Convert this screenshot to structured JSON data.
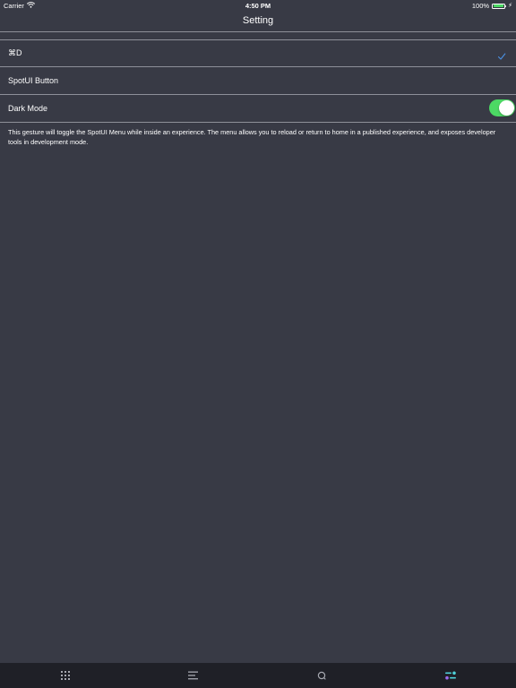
{
  "status_bar": {
    "carrier": "Carrier",
    "time": "4:50 PM",
    "battery": "100%",
    "battery_level": 1.0
  },
  "nav": {
    "title": "Setting"
  },
  "settings": {
    "rows": [
      {
        "label": "⌘D",
        "accessory": "checkmark-icon",
        "selected": true
      },
      {
        "label": "SpotUI Button"
      },
      {
        "label": "Dark Mode",
        "accessory": "toggle",
        "on": true
      }
    ]
  },
  "description": "This gesture will toggle the SpotUI Menu while inside an experience. The menu allows you to reload or return to home in a published experience, and exposes developer tools in development mode.",
  "tab_bar": {
    "tabs": [
      {
        "icon": "grid-icon"
      },
      {
        "icon": "list-icon"
      },
      {
        "icon": "search-icon"
      },
      {
        "icon": "settings-sliders-icon",
        "active": true
      }
    ]
  },
  "colors": {
    "background": "#383a45",
    "tab_bar_background": "#1f2027",
    "divider": "#8e9099",
    "accent_blue": "#4a90e2",
    "toggle_on": "#4cd964",
    "tab_icon": "#a6a8b0",
    "active_cyan": "#4fd1d9",
    "active_purple": "#9b6cf0"
  }
}
